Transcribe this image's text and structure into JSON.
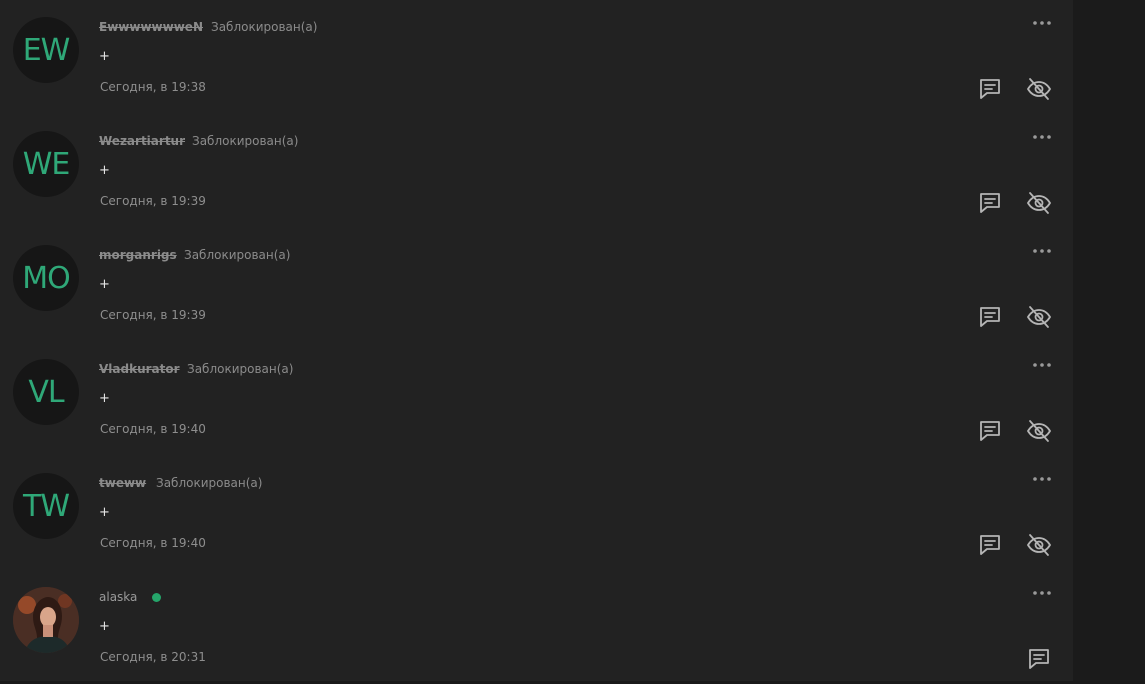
{
  "comments": [
    {
      "initials": "EW",
      "author": "EwwwwwwweN",
      "status": "Заблокирован(а)",
      "text": "+",
      "time": "Сегодня, в 19:38",
      "blocked": true
    },
    {
      "initials": "WE",
      "author": "Wezartiartur",
      "status": "Заблокирован(а)",
      "text": "+",
      "time": "Сегодня, в 19:39",
      "blocked": true
    },
    {
      "initials": "MO",
      "author": "morganrigs",
      "status": "Заблокирован(а)",
      "text": "+",
      "time": "Сегодня, в 19:39",
      "blocked": true
    },
    {
      "initials": "VL",
      "author": "Vladkurator",
      "status": "Заблокирован(а)",
      "text": "+",
      "time": "Сегодня, в 19:40",
      "blocked": true
    },
    {
      "initials": "TW",
      "author": "tweww",
      "status": "Заблокирован(а)",
      "text": "+",
      "time": "Сегодня, в 19:40",
      "blocked": true
    },
    {
      "initials": "",
      "author": "alaska",
      "status": "",
      "text": "+",
      "time": "Сегодня, в 20:31",
      "blocked": false
    }
  ],
  "icons": {
    "more": "more-dots-icon",
    "reply": "reply-comment-icon",
    "hide": "eye-off-icon"
  },
  "colors": {
    "panel": "#222222",
    "accent": "#2fa878",
    "online": "#25a56a"
  }
}
